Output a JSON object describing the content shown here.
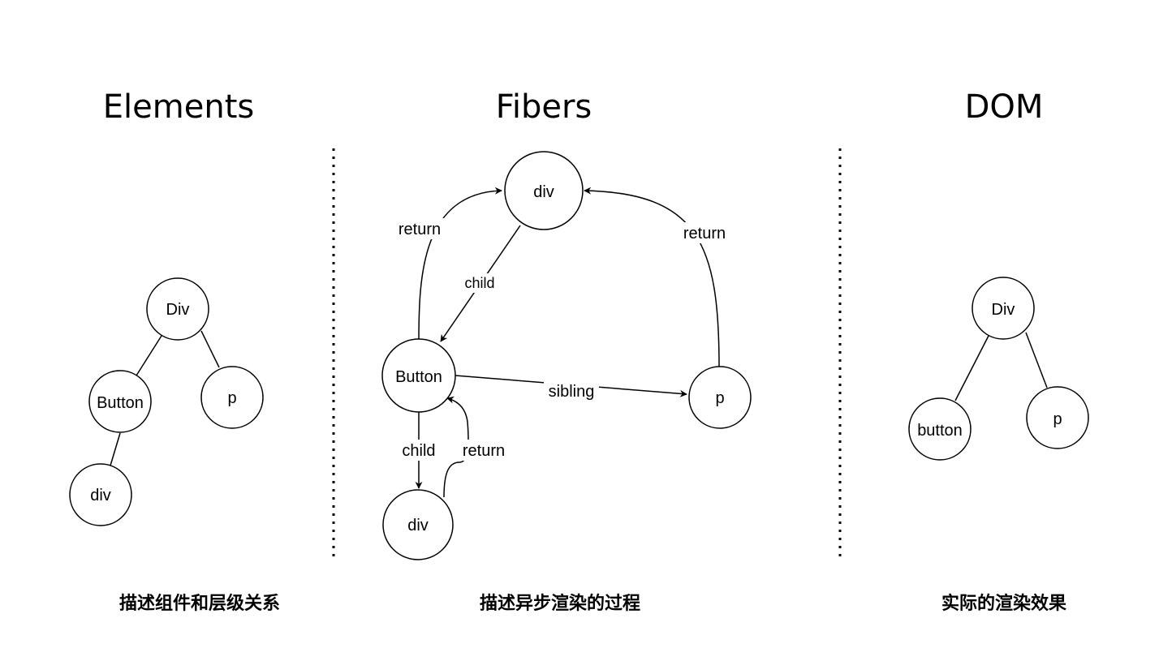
{
  "sections": {
    "elements": {
      "title": "Elements",
      "caption": "描述组件和层级关系",
      "nodes": {
        "root": "Div",
        "button": "Button",
        "p": "p",
        "div": "div"
      }
    },
    "fibers": {
      "title": "Fibers",
      "caption": "描述异步渲染的过程",
      "nodes": {
        "div": "div",
        "button": "Button",
        "p": "p",
        "child_div": "div"
      },
      "edges": {
        "child_top": "child",
        "return_left": "return",
        "return_right": "return",
        "sibling": "sibling",
        "child_bottom": "child",
        "return_bottom": "return"
      }
    },
    "dom": {
      "title": "DOM",
      "caption": "实际的渲染效果",
      "nodes": {
        "root": "Div",
        "button": "button",
        "p": "p"
      }
    }
  }
}
